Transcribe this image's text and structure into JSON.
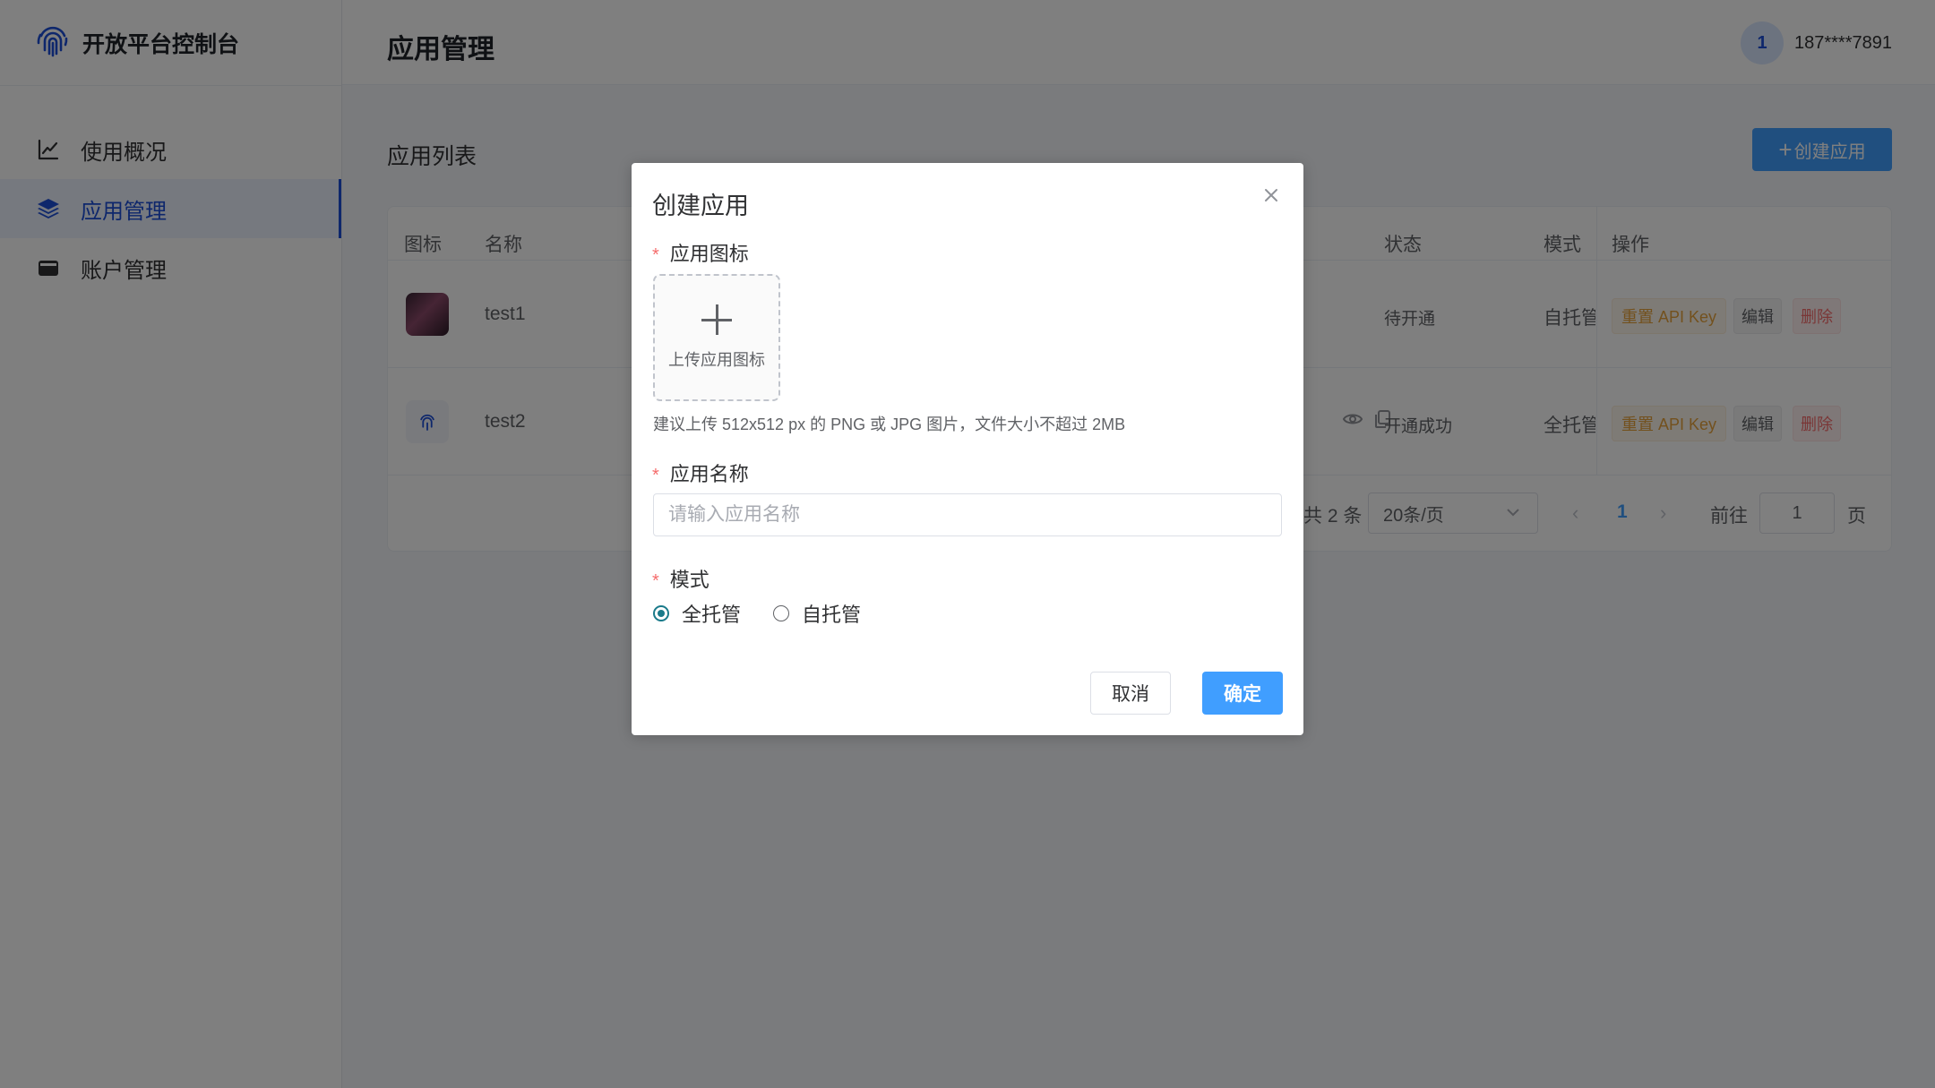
{
  "sidebar": {
    "brand_title": "开放平台控制台",
    "items": [
      {
        "label": "使用概况",
        "icon": "line-chart-icon",
        "active": false
      },
      {
        "label": "应用管理",
        "icon": "layers-icon",
        "active": true
      },
      {
        "label": "账户管理",
        "icon": "wallet-icon",
        "active": false
      }
    ]
  },
  "header": {
    "title": "应用管理",
    "avatar_text": "1",
    "phone": "187****7891"
  },
  "main": {
    "section_title": "应用列表",
    "create_button": "创建应用",
    "table": {
      "columns": {
        "icon": "图标",
        "name": "名称",
        "status": "状态",
        "mode": "模式",
        "actions": "操作"
      },
      "rows": [
        {
          "name": "test1",
          "status": "待开通",
          "mode": "自托管"
        },
        {
          "name": "test2",
          "status": "开通成功",
          "mode": "全托管"
        }
      ],
      "actions": {
        "reset": "重置 API Key",
        "edit": "编辑",
        "delete": "删除"
      }
    },
    "pagination": {
      "total_text": "共 2 条",
      "page_size": "20条/页",
      "current_page": "1",
      "goto_label": "前往",
      "goto_value": "1",
      "page_suffix": "页"
    }
  },
  "dialog": {
    "title": "创建应用",
    "icon_label": "应用图标",
    "upload_text": "上传应用图标",
    "upload_hint": "建议上传 512x512 px 的 PNG 或 JPG 图片，文件大小不超过 2MB",
    "name_label": "应用名称",
    "name_placeholder": "请输入应用名称",
    "mode_label": "模式",
    "modes": [
      {
        "label": "全托管",
        "checked": true
      },
      {
        "label": "自托管",
        "checked": false
      }
    ],
    "cancel": "取消",
    "confirm": "确定",
    "required_mark": "*"
  },
  "colors": {
    "primary": "#409eff",
    "brand_blue": "#1d4fd8",
    "radio_checked": "#1a7a8a",
    "warning": "#e6a23c",
    "danger": "#f56c6c"
  }
}
